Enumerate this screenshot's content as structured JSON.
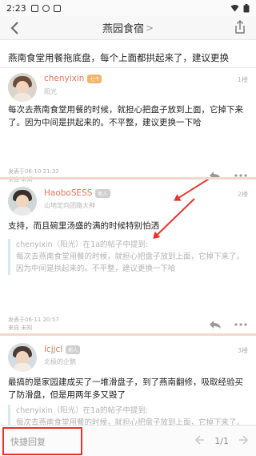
{
  "status_bar": {
    "time": "2:23"
  },
  "header": {
    "title": "燕园食宿",
    "title_chevron": ">"
  },
  "thread": {
    "title": "燕南食堂用餐拖底盘，每个上面都拱起来了，建议更换"
  },
  "posts": [
    {
      "username": "chenyixin",
      "badge": "七个",
      "subtitle": "阳光",
      "floor": "1楼",
      "text": "每次去燕南食堂用餐的时候，就担心把盘子放到上面，它掉下来了。因为中间是拱起来的。不平整，建议更换一下哈",
      "meta_time": "发表于06-10 21:32",
      "meta_from": "来自 未知"
    },
    {
      "username": "HaoboSESS",
      "badge": "新人",
      "subtitle": "山地定向团路大神",
      "floor": "2楼",
      "text": "支持，而且碗里汤盛的满的时候特别怕洒",
      "quote_head": "chenyixin（阳光）在1a的帖子中提到:",
      "quote_text": "每次去燕南食堂用餐的时候，就担心把盘子放到上面，它掉下来了。因为中间是拱起来的。不平整，建议更换一下哈",
      "meta_time": "发表于06-11 20:57",
      "meta_from": "来自 未知"
    },
    {
      "username": "lcjjcl",
      "badge": "新人",
      "subtitle": "北极的企鹅",
      "floor": "3楼",
      "text": "最搞的是家园建成买了一堆滑盘子，到了燕南翻修，吸取经验买了防滑盘，但是用两年多又毁了",
      "quote_head": "chenyixin（阳光）在1a的帖子中提到:",
      "quote_text": "每次去燕南食堂用餐的时候，就担心把盘子放到上面，它掉下来了。因为中间是拱起来的。不平整，建议更换一下哈"
    }
  ],
  "bottom_bar": {
    "quick_reply": "快捷回复",
    "page": "1/1"
  },
  "colors": {
    "accent": "#e7735a",
    "annotation": "#e8342c"
  }
}
